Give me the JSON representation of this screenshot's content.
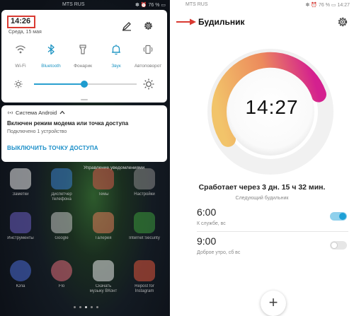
{
  "left_panel": {
    "status_bar": {
      "carrier": "MTS RUS",
      "indicators": "✽ ⏰ 76 % ▭"
    },
    "quick_settings": {
      "time": "14:26",
      "date": "Среда, 15 мая",
      "edit_icon": "pencil-icon",
      "settings_icon": "gear-icon",
      "tiles": [
        {
          "label": "Wi-Fi",
          "icon": "wifi-icon",
          "active": false
        },
        {
          "label": "Bluetooth",
          "icon": "bluetooth-icon",
          "active": true
        },
        {
          "label": "Фонарик",
          "icon": "flashlight-icon",
          "active": false
        },
        {
          "label": "Звук",
          "icon": "bell-icon",
          "active": true
        },
        {
          "label": "Автоповорот",
          "icon": "rotate-icon",
          "active": false
        }
      ],
      "brightness": 0.49
    },
    "notification": {
      "source": "Система Android",
      "title": "Включен режим модема или точка доступа",
      "subtitle": "Подключено 1 устройство",
      "action": "ВЫКЛЮЧИТЬ ТОЧКУ ДОСТУПА"
    },
    "manage_notifications": "Управление уведомлениями",
    "apps": [
      {
        "name": "Заметки"
      },
      {
        "name": "Диспетчер\nтелефона"
      },
      {
        "name": "Темы"
      },
      {
        "name": "Настройки"
      },
      {
        "name": "Инструменты"
      },
      {
        "name": "Google"
      },
      {
        "name": "Галерея"
      },
      {
        "name": "Internet Security"
      },
      {
        "name": "Юла"
      },
      {
        "name": "Flo"
      },
      {
        "name": "Скачать\nмузыку ВКонт"
      },
      {
        "name": "Repost for\nInstagram"
      }
    ]
  },
  "right_panel": {
    "status_bar": {
      "carrier": "MTS RUS",
      "indicators": "✽ ⏰ 76 % ▭",
      "time": "14:27"
    },
    "title": "Будильник",
    "settings_icon": "gear-icon",
    "clock_time": "14:27",
    "countdown": "Сработает через 3 дн. 15 ч 32 мин.",
    "next_alarm_label": "Следующий будильник",
    "alarms": [
      {
        "time": "6:00",
        "description": "К службе, вс",
        "enabled": true
      },
      {
        "time": "9:00",
        "description": "Доброе утро, сб вс",
        "enabled": false
      }
    ],
    "add_button": "+",
    "colors": {
      "accent": "#1ea0d6",
      "ring_start": "#f2c46a",
      "ring_end": "#d4208f"
    }
  }
}
